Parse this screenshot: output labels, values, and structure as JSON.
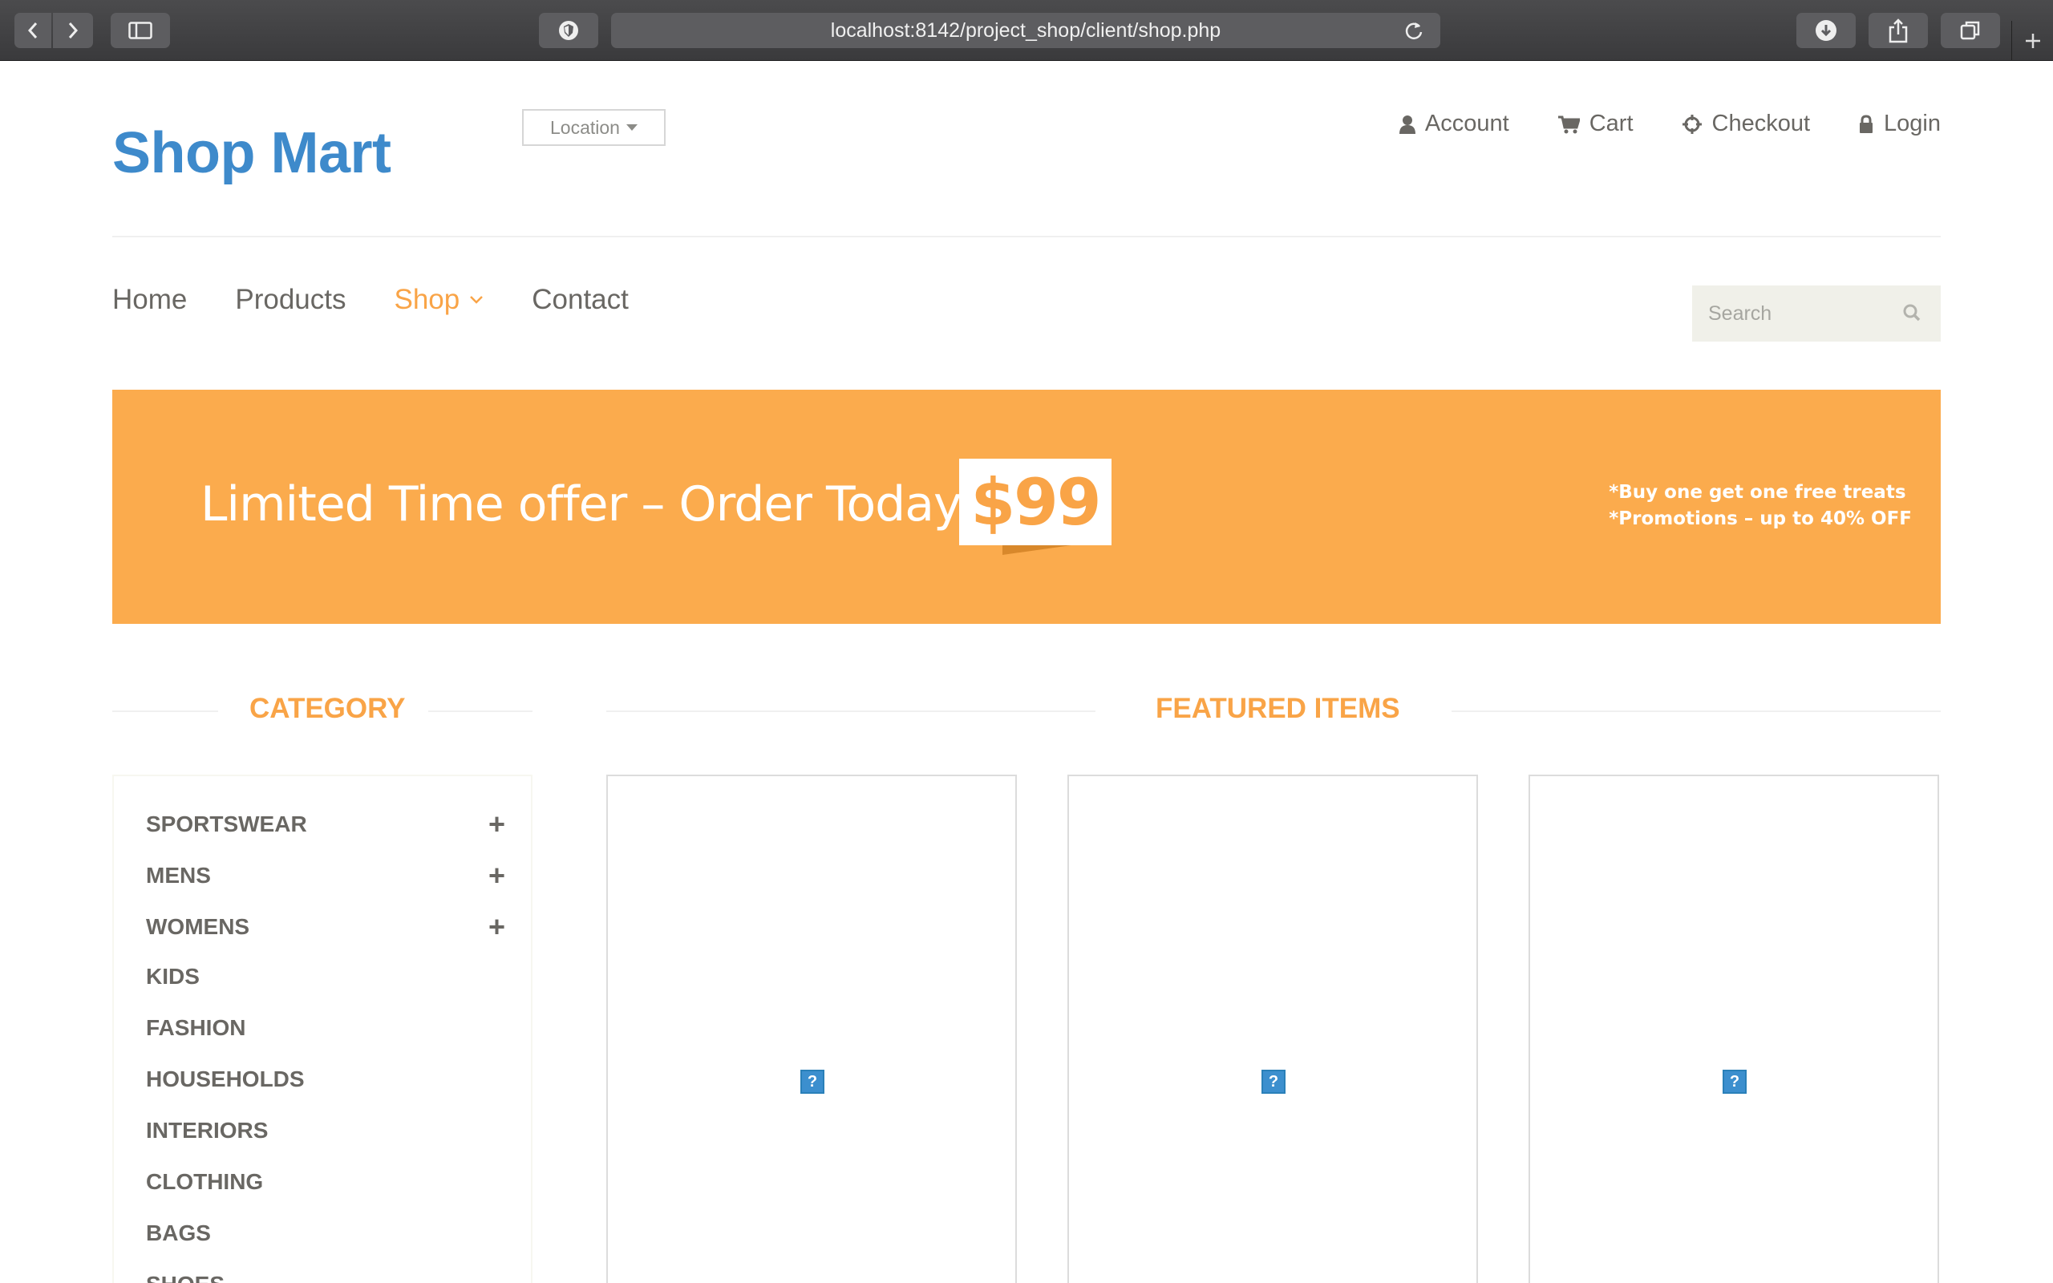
{
  "browser": {
    "url": "localhost:8142/project_shop/client/shop.php"
  },
  "header": {
    "logo": "Shop Mart",
    "location_label": "Location",
    "top_links": [
      {
        "label": "Account",
        "icon": "user-icon"
      },
      {
        "label": "Cart",
        "icon": "cart-icon"
      },
      {
        "label": "Checkout",
        "icon": "crosshair-icon"
      },
      {
        "label": "Login",
        "icon": "lock-icon"
      }
    ]
  },
  "nav": {
    "items": [
      {
        "label": "Home"
      },
      {
        "label": "Products"
      },
      {
        "label": "Shop"
      },
      {
        "label": "Contact"
      }
    ],
    "search_placeholder": "Search"
  },
  "banner": {
    "text": "Limited Time offer – Order Today For",
    "price": "$99",
    "promo_line1": "*Buy one get one free treats",
    "promo_line2": "*Promotions – up to 40% OFF"
  },
  "category": {
    "title": "CATEGORY",
    "items": [
      {
        "label": "SPORTSWEAR",
        "expandable": "+"
      },
      {
        "label": "MENS",
        "expandable": "+"
      },
      {
        "label": "WOMENS",
        "expandable": "+"
      },
      {
        "label": "KIDS",
        "expandable": ""
      },
      {
        "label": "FASHION",
        "expandable": ""
      },
      {
        "label": "HOUSEHOLDS",
        "expandable": ""
      },
      {
        "label": "INTERIORS",
        "expandable": ""
      },
      {
        "label": "CLOTHING",
        "expandable": ""
      },
      {
        "label": "BAGS",
        "expandable": ""
      },
      {
        "label": "SHOES",
        "expandable": ""
      }
    ]
  },
  "featured": {
    "title": "FEATURED ITEMS",
    "placeholder_glyph": "?"
  },
  "colors": {
    "brand_blue": "#3e8acb",
    "accent_orange": "#f9a447",
    "banner_orange": "#fbab4d"
  }
}
